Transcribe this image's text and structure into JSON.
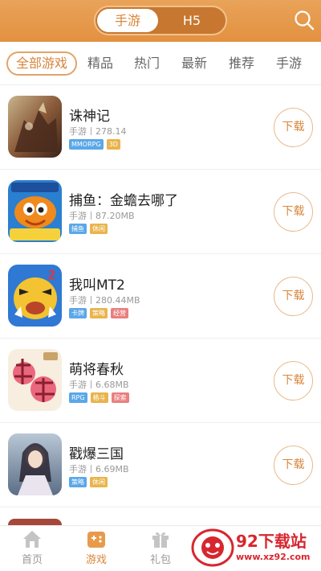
{
  "header": {
    "segments": [
      {
        "label": "手游",
        "selected": true
      },
      {
        "label": "H5",
        "selected": false
      }
    ],
    "search_icon": "search-icon"
  },
  "categories": [
    {
      "label": "全部游戏",
      "selected": true
    },
    {
      "label": "精品"
    },
    {
      "label": "热门"
    },
    {
      "label": "最新"
    },
    {
      "label": "推荐"
    },
    {
      "label": "手游"
    }
  ],
  "games": [
    {
      "name": "诛神记",
      "type": "手游",
      "size": "278.14",
      "tags": [
        {
          "text": "MMORPG",
          "color": "#5ba7e8"
        },
        {
          "text": "3D",
          "color": "#e9b44c"
        }
      ],
      "download_label": "下载"
    },
    {
      "name": "捕鱼：金蟾去哪了",
      "type": "手游",
      "size": "87.20MB",
      "tags": [
        {
          "text": "捕鱼",
          "color": "#5ba7e8"
        },
        {
          "text": "休闲",
          "color": "#e9b44c"
        }
      ],
      "download_label": "下载"
    },
    {
      "name": "我叫MT2",
      "type": "手游",
      "size": "280.44MB",
      "tags": [
        {
          "text": "卡牌",
          "color": "#5ba7e8"
        },
        {
          "text": "策略",
          "color": "#e9b44c"
        },
        {
          "text": "经营",
          "color": "#e97f7f"
        }
      ],
      "download_label": "下载"
    },
    {
      "name": "萌将春秋",
      "type": "手游",
      "size": "6.68MB",
      "tags": [
        {
          "text": "RPG",
          "color": "#5ba7e8"
        },
        {
          "text": "格斗",
          "color": "#e9b44c"
        },
        {
          "text": "探索",
          "color": "#e97f7f"
        }
      ],
      "download_label": "下载"
    },
    {
      "name": "戳爆三国",
      "type": "手游",
      "size": "6.69MB",
      "tags": [
        {
          "text": "策略",
          "color": "#5ba7e8"
        },
        {
          "text": "休闲",
          "color": "#e9b44c"
        }
      ],
      "download_label": "下载"
    }
  ],
  "tabbar": [
    {
      "label": "首页",
      "icon": "home-icon",
      "active": false
    },
    {
      "label": "游戏",
      "icon": "gamepad-icon",
      "active": true
    },
    {
      "label": "礼包",
      "icon": "gift-icon",
      "active": false
    }
  ],
  "watermark": {
    "title": "92下载站",
    "url": "www.xz92.com"
  },
  "colors": {
    "accent": "#d9853a",
    "header": "#e2913f"
  }
}
